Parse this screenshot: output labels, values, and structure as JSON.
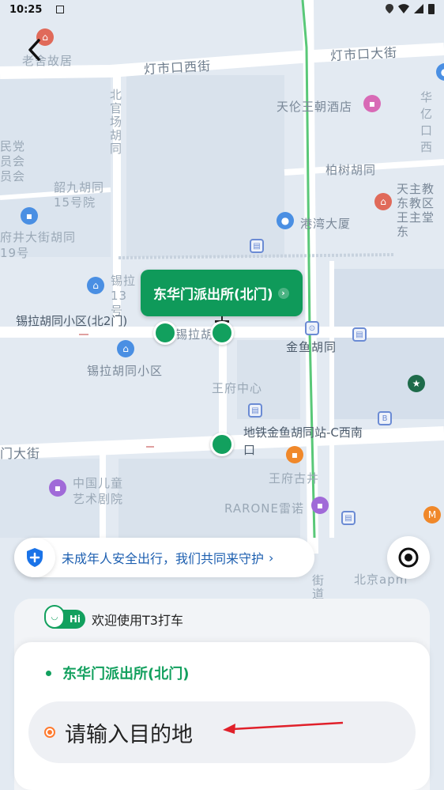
{
  "status_bar": {
    "time": "10:25"
  },
  "map": {
    "labels": {
      "dengshikou_west": "灯市口西街",
      "dengshikou_main": "灯市口大街",
      "laoshe": "老舍故居",
      "beiguanchang": "北官场胡同",
      "tianlun": "天伦王朝酒店",
      "huayi": "华亿口西",
      "baishu": "柏树胡同",
      "tianzhu": "天主教东教区王主堂东",
      "gangwan": "港湾大厦",
      "shaojiu": "韶九胡同15号院",
      "fujingdajie": "府井大街胡同19号",
      "minzhudang": "民党员会员会",
      "xila_13": "锡拉13号",
      "xila_community_north": "锡拉胡同小区(北2门)",
      "xila_hutong": "锡拉胡",
      "xila_community": "锡拉胡同小区",
      "jinyu": "金鱼胡同",
      "wangfu_center": "王府中心",
      "metro_exit": "地铁金鱼胡同站-C西南口",
      "dongan_street": "门大街",
      "wangfu_gujing": "王府古井",
      "children_theater": "中国儿童艺术剧院",
      "rarone": "RARONE雷诺",
      "beijing_apm": "北京apm",
      "jiedao": "街道"
    }
  },
  "pickup": {
    "label": "东华门派出所(北门)"
  },
  "safety": {
    "text": "未成年人安全出行，我们共同来守护"
  },
  "sheet": {
    "welcome_badge": "Hi",
    "welcome_text": "欢迎使用T3打车",
    "from_location": "东华门派出所(北门)",
    "destination_placeholder": "请输入目的地"
  },
  "colors": {
    "brand_green": "#12A05E",
    "banner_blue": "#1D5FB0",
    "destination_orange": "#FF7A2E",
    "annotation_red": "#E0202A"
  }
}
